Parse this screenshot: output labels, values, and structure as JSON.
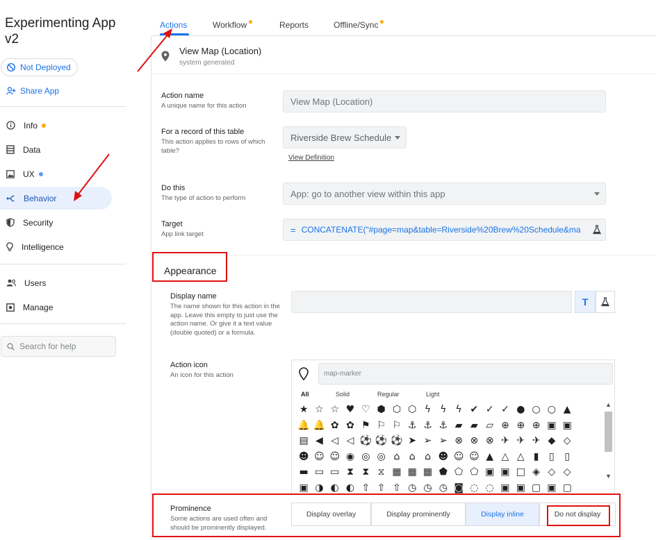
{
  "app": {
    "title": "Experimenting App v2",
    "deploy_status": "Not Deployed",
    "share_label": "Share App"
  },
  "nav": {
    "items": [
      {
        "label": "Info",
        "icon": "info-icon",
        "badge": "orange"
      },
      {
        "label": "Data",
        "icon": "data-icon",
        "badge": ""
      },
      {
        "label": "UX",
        "icon": "ux-icon",
        "badge": "blue"
      },
      {
        "label": "Behavior",
        "icon": "behavior-icon",
        "badge": "",
        "active": true
      },
      {
        "label": "Security",
        "icon": "shield-icon",
        "badge": ""
      },
      {
        "label": "Intelligence",
        "icon": "lightbulb-icon",
        "badge": ""
      },
      {
        "label": "Users",
        "icon": "users-icon",
        "badge": ""
      },
      {
        "label": "Manage",
        "icon": "manage-icon",
        "badge": ""
      }
    ],
    "search_placeholder": "Search for help"
  },
  "tabs": [
    {
      "label": "Actions",
      "active": true,
      "badge": false
    },
    {
      "label": "Workflow",
      "active": false,
      "badge": true
    },
    {
      "label": "Reports",
      "active": false,
      "badge": false
    },
    {
      "label": "Offline/Sync",
      "active": false,
      "badge": true
    }
  ],
  "action": {
    "title": "View Map (Location)",
    "subtitle": "system generated"
  },
  "form": {
    "action_name": {
      "label": "Action name",
      "desc": "A unique name for this action",
      "value": "View Map (Location)"
    },
    "table": {
      "label": "For a record of this table",
      "desc": "This action applies to rows of which table?",
      "value": "Riverside Brew Schedule",
      "link": "View Definition"
    },
    "do_this": {
      "label": "Do this",
      "desc": "The type of action to perform",
      "value": "App: go to another view within this app"
    },
    "target": {
      "label": "Target",
      "desc": "App link target",
      "eq": "=",
      "value": "CONCATENATE(\"#page=map&table=Riverside%20Brew%20Schedule&ma"
    }
  },
  "appearance": {
    "heading": "Appearance",
    "display_name": {
      "label": "Display name",
      "desc": "The name shown for this action in the app. Leave this empty to just use the action name. Or give it a text value (double quoted) or a formula.",
      "value": "",
      "toggle_label": "T"
    },
    "action_icon": {
      "label": "Action icon",
      "desc": "An icon for this action",
      "search_value": "map-marker",
      "filters": [
        "All",
        "Solid",
        "Regular",
        "Light"
      ]
    },
    "prominence": {
      "label": "Prominence",
      "desc": "Some actions are used often and should be prominently displayed.",
      "options": [
        "Display overlay",
        "Display prominently",
        "Display inline",
        "Do not display"
      ],
      "selected": "Display inline"
    }
  },
  "icon_rows": [
    [
      "★",
      "☆",
      "☆",
      "♥",
      "♡",
      "⬢",
      "⬡",
      "⬡",
      "ϟ",
      "ϟ",
      "ϟ",
      "✔",
      "✓",
      "✓",
      "●",
      "○",
      "○",
      "▲"
    ],
    [
      "🔔",
      "🔔",
      "✿",
      "✿",
      "⚑",
      "⚐",
      "⚐",
      "⚓",
      "⚓",
      "⚓",
      "▰",
      "▰",
      "▱",
      "⊕",
      "⊕",
      "⊕",
      "▣",
      "▣"
    ],
    [
      "▤",
      "◀",
      "◁",
      "◁",
      "⚽",
      "⚽",
      "⚽",
      "➤",
      "➢",
      "➢",
      "⊗",
      "⊗",
      "⊗",
      "✈",
      "✈",
      "✈",
      "◆",
      "◇"
    ],
    [
      "☻",
      "☺",
      "☺",
      "◉",
      "◎",
      "◎",
      "⌂",
      "⌂",
      "⌂",
      "☻",
      "☺",
      "☺",
      "▲",
      "△",
      "△",
      "▮",
      "▯",
      "▯"
    ],
    [
      "▬",
      "▭",
      "▭",
      "⧗",
      "⧗",
      "⧖",
      "▦",
      "▦",
      "▦",
      "⬟",
      "⬠",
      "⬠",
      "▣",
      "▣",
      "□",
      "◈",
      "◇",
      "◇"
    ],
    [
      "▣",
      "◑",
      "◐",
      "◐",
      "⇧",
      "⇧",
      "⇧",
      "◷",
      "◷",
      "◷",
      "◙",
      "◌",
      "◌",
      "▣",
      "▣",
      "▢",
      "▣",
      "▢"
    ]
  ],
  "colors": {
    "accent": "#1a73e8",
    "highlight": "#e01010",
    "active_bg": "#e8f0fe"
  }
}
